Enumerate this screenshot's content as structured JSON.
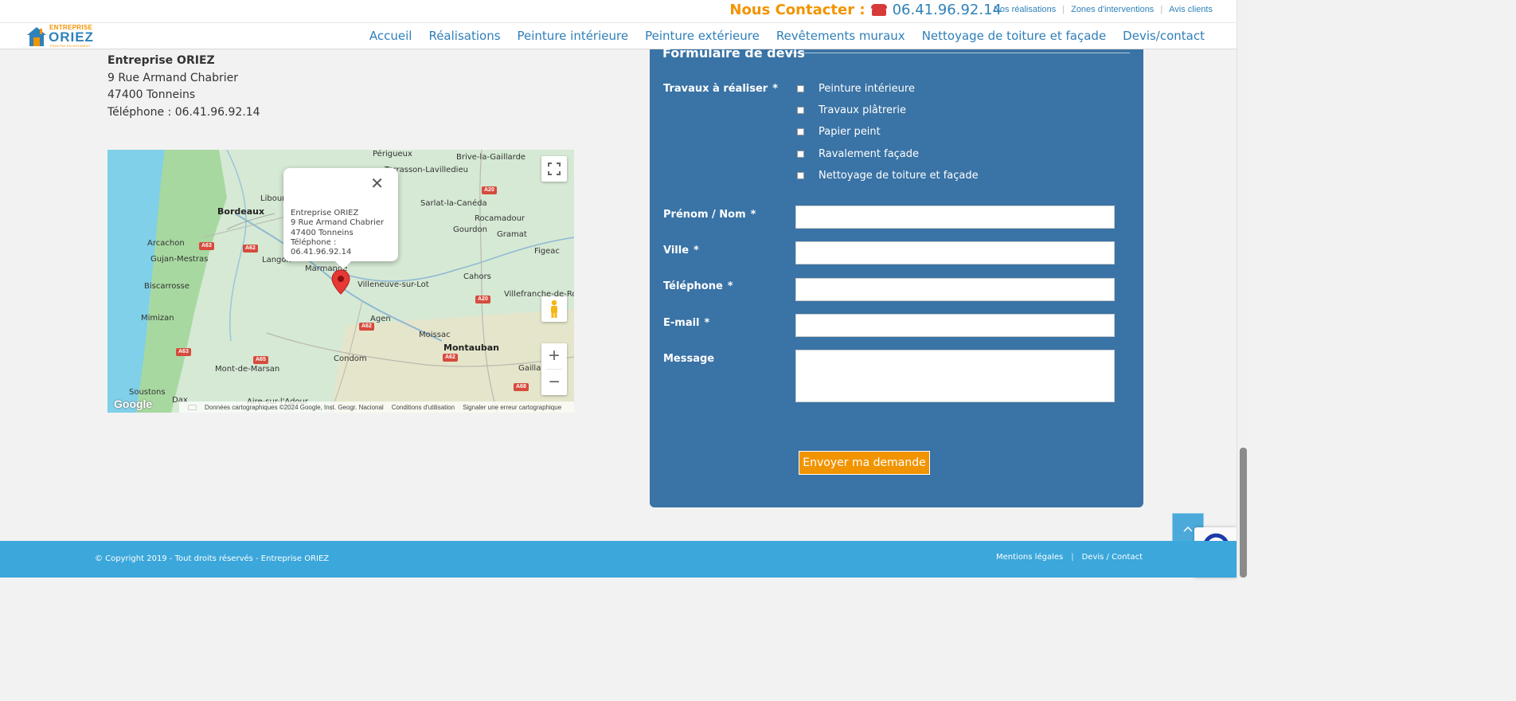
{
  "header": {
    "contact_label": "Nous Contacter :",
    "contact_phone": "06.41.96.92.14",
    "top_links": [
      "Nos réalisations",
      "Zones d'interventions",
      "Avis clients"
    ],
    "logo": {
      "small": "ENTREPRISE",
      "big": "ORIEZ",
      "tagline": "PEINTRE EN BATIMENT"
    },
    "nav": [
      "Accueil",
      "Réalisations",
      "Peinture intérieure",
      "Peinture extérieure",
      "Revêtements muraux",
      "Nettoyage de toiture et façade",
      "Devis/contact"
    ]
  },
  "address": {
    "name": "Entreprise ORIEZ",
    "street": "9 Rue Armand Chabrier",
    "city": "47400 Tonneins",
    "phone": "Téléphone : 06.41.96.92.14"
  },
  "map": {
    "labels": {
      "bordeaux": "Bordeaux",
      "perigueux": "Périgueux",
      "brive": "Brive-la-Gaillarde",
      "terrasson": "Terrasson-Lavilledieu",
      "sarlat": "Sarlat-la-Canéda",
      "rocamadour": "Rocamadour",
      "gourdon": "Gourdon",
      "gramat": "Gramat",
      "figeac": "Figeac",
      "arcachon": "Arcachon",
      "gujan": "Gujan-Mestras",
      "libourne": "Libourne",
      "langon": "Langon",
      "marmande": "Marmande",
      "villeneuve": "Villeneuve-sur-Lot",
      "cahors": "Cahors",
      "villefranche": "Villefranche-de-Roue",
      "biscarrosse": "Biscarrosse",
      "mimizan": "Mimizan",
      "agen": "Agen",
      "moissac": "Moissac",
      "montauban": "Montauban",
      "condom": "Condom",
      "montdemarsan": "Mont-de-Marsan",
      "gaillac": "Gaillac",
      "soustons": "Soustons",
      "dax": "Dax",
      "aire": "Aire-sur-l'Adour"
    },
    "roads": [
      "A20",
      "A63",
      "A62",
      "A62",
      "A20",
      "A63",
      "A65",
      "A62",
      "A68"
    ],
    "popup": {
      "line1": "Entreprise ORIEZ",
      "line2": "9 Rue Armand Chabrier",
      "line3": "47400 Tonneins",
      "line4": "Téléphone : 06.41.96.92.14"
    },
    "google": "Google",
    "footer": {
      "data": "Données cartographiques ©2024 Google, Inst. Geogr. Nacional",
      "terms": "Conditions d'utilisation",
      "report": "Signaler une erreur cartographique"
    }
  },
  "form": {
    "title": "Formulaire de devis",
    "travaux_label": "Travaux à réaliser",
    "required_mark": "*",
    "checkboxes": [
      "Peinture intérieure",
      "Travaux plâtrerie",
      "Papier peint",
      "Ravalement façade",
      "Nettoyage de toiture et façade"
    ],
    "fields": {
      "name": "Prénom / Nom",
      "city": "Ville",
      "phone": "Téléphone",
      "email": "E-mail",
      "message": "Message"
    },
    "submit": "Envoyer ma demande"
  },
  "footer": {
    "copyright": "© Copyright 2019 - Tout droits réservés - Entreprise ORIEZ",
    "links": [
      "Mentions légales",
      "Devis / Contact"
    ]
  },
  "colors": {
    "accent_orange": "#f29400",
    "brand_blue": "#2f82b9",
    "form_bg": "#3a73a5",
    "footer_bg": "#3ba7db"
  }
}
